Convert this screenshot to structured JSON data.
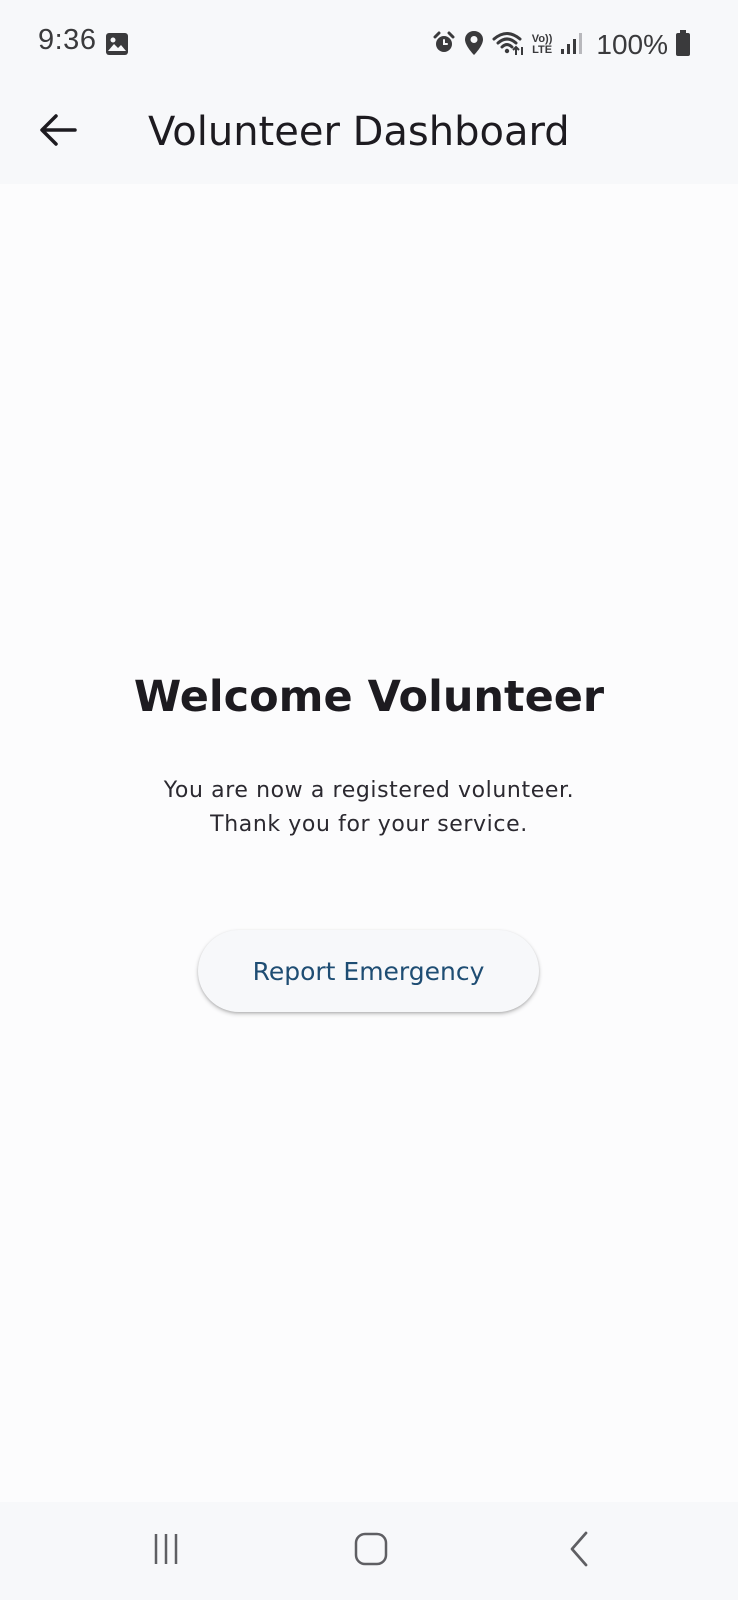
{
  "status_bar": {
    "time": "9:36",
    "battery_percent": "100%",
    "network_label_top": "Vo))",
    "network_label_bottom": "LTE",
    "icons": [
      "gallery-icon",
      "alarm-icon",
      "location-icon",
      "wifi-icon",
      "volte-icon",
      "signal-icon",
      "battery-icon"
    ]
  },
  "app_bar": {
    "title": "Volunteer Dashboard",
    "back_icon": "arrow-back-icon"
  },
  "main": {
    "welcome_title": "Welcome Volunteer",
    "message_line1": "You are now a registered volunteer.",
    "message_line2": "Thank you for your service.",
    "report_button_label": "Report Emergency"
  },
  "nav_bar": {
    "icons": [
      "recent-apps-icon",
      "home-icon",
      "back-icon"
    ]
  },
  "colors": {
    "background": "#fcfcfd",
    "bar_background": "#f7f8fa",
    "title_text": "#1d1b20",
    "button_text": "#1e4d73"
  }
}
